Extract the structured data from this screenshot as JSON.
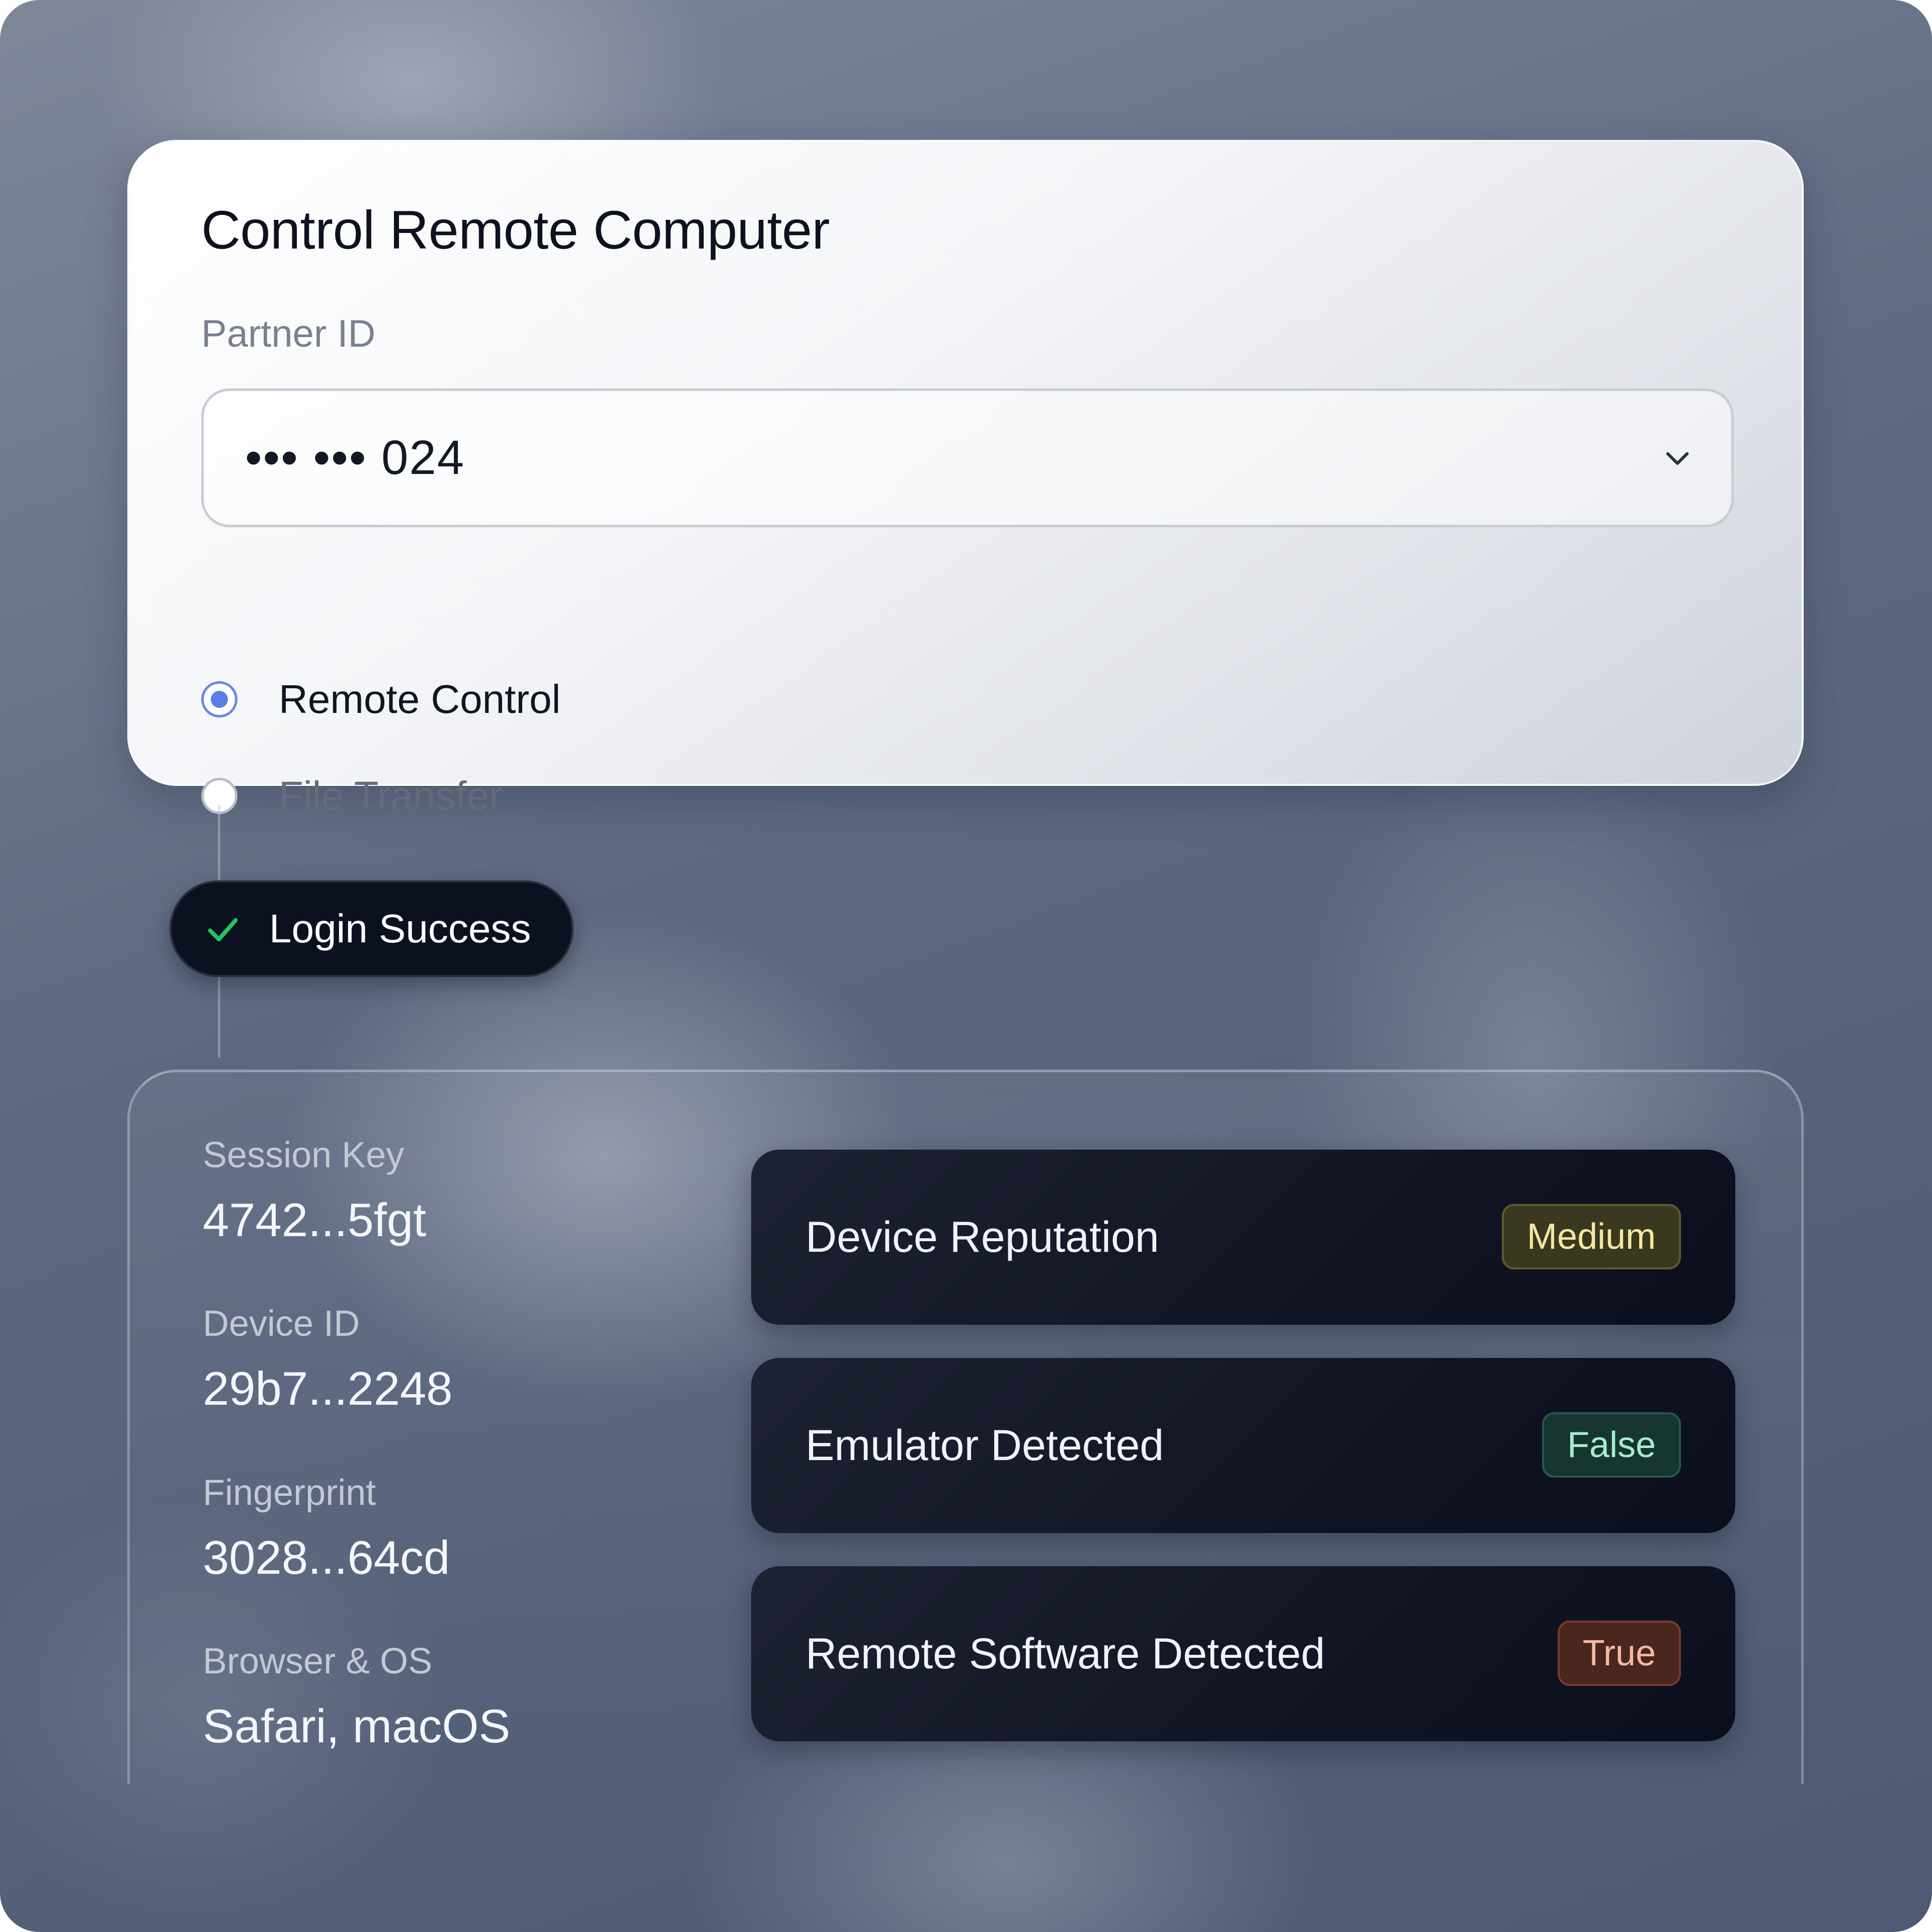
{
  "remote_panel": {
    "title": "Control Remote Computer",
    "partner_id_label": "Partner ID",
    "partner_id_value": "••• ••• 024",
    "options": [
      {
        "label": "Remote Control",
        "selected": true
      },
      {
        "label": "File Transfer",
        "selected": false
      }
    ]
  },
  "status": {
    "label": "Login Success",
    "icon": "check-icon",
    "color": "#22c55e"
  },
  "session": {
    "fields": [
      {
        "label": "Session Key",
        "value": "4742...5fgt"
      },
      {
        "label": "Device ID",
        "value": "29b7...2248"
      },
      {
        "label": "Fingerprint",
        "value": "3028...64cd"
      },
      {
        "label": "Browser & OS",
        "value": "Safari, macOS"
      }
    ],
    "signals": [
      {
        "label": "Device Reputation",
        "badge": "Medium",
        "badge_color": "#f3e8a2"
      },
      {
        "label": "Emulator Detected",
        "badge": "False",
        "badge_color": "#a7ecd2"
      },
      {
        "label": "Remote Software Detected",
        "badge": "True",
        "badge_color": "#f6b8a6"
      }
    ]
  },
  "colors": {
    "accent": "#5b7fe4",
    "pill_background": "#0c1120"
  }
}
